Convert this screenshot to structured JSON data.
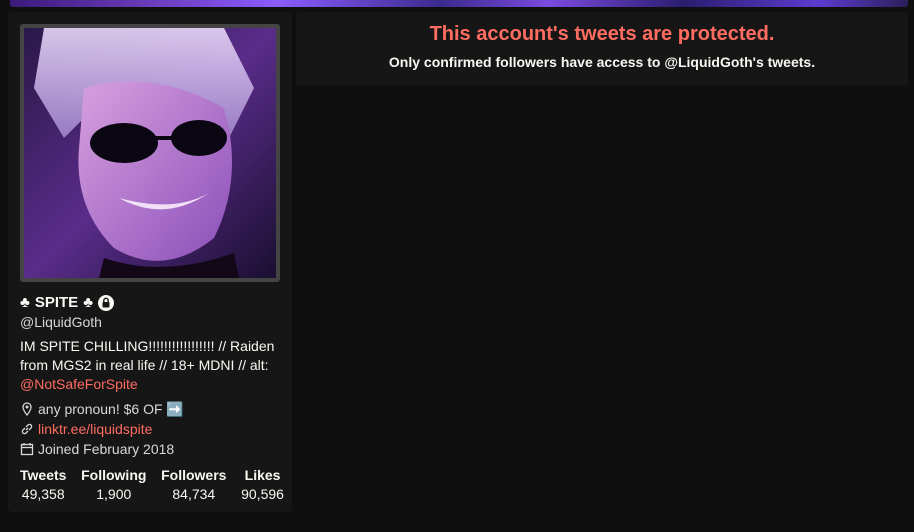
{
  "profile": {
    "fullname_prefix_emoji": "♣",
    "fullname": "SPITE",
    "fullname_suffix_emoji": "♣",
    "username": "@LiquidGoth",
    "bio_text": "IM SPITE CHILLING!!!!!!!!!!!!!!!!! // Raiden from MGS2 in real life // 18+ MDNI // alt: ",
    "bio_link": "@NotSafeForSpite",
    "location": "any pronoun! $6 OF ➡️",
    "website": "linktr.ee/liquidspite",
    "joined": "Joined February 2018",
    "icons": {
      "lock": "lock-icon",
      "location": "location-pin-icon",
      "website": "link-icon",
      "joined": "calendar-icon"
    }
  },
  "stats": [
    {
      "label": "Tweets",
      "value": "49,358"
    },
    {
      "label": "Following",
      "value": "1,900"
    },
    {
      "label": "Followers",
      "value": "84,734"
    },
    {
      "label": "Likes",
      "value": "90,596"
    }
  ],
  "timeline": {
    "title": "This account's tweets are protected.",
    "description": "Only confirmed followers have access to @LiquidGoth's tweets."
  },
  "colors": {
    "accent": "#ff6c60",
    "background": "#0f0f0f",
    "panel": "#161616"
  }
}
